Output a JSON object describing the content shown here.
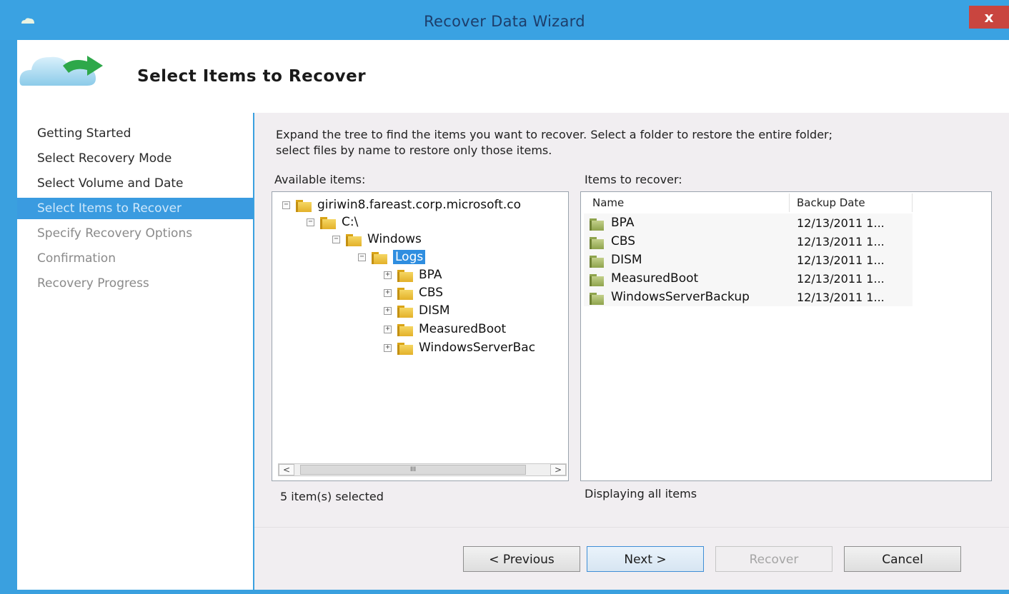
{
  "window": {
    "title": "Recover Data Wizard",
    "close_label": "x"
  },
  "header": {
    "title": "Select Items to Recover"
  },
  "sidebar": {
    "steps": [
      {
        "label": "Getting Started",
        "state": "done"
      },
      {
        "label": "Select Recovery Mode",
        "state": "done"
      },
      {
        "label": "Select Volume and Date",
        "state": "done"
      },
      {
        "label": "Select Items to Recover",
        "state": "active"
      },
      {
        "label": "Specify Recovery Options",
        "state": "pending"
      },
      {
        "label": "Confirmation",
        "state": "pending"
      },
      {
        "label": "Recovery Progress",
        "state": "pending"
      }
    ]
  },
  "main": {
    "description_line1": "Expand the tree to find the items you want to recover. Select a folder to restore the entire folder;",
    "description_line2": "select files by name to restore only those items.",
    "available_label": "Available items:",
    "recover_label": "Items to recover:",
    "tree": {
      "root": "giriwin8.fareast.corp.microsoft.co",
      "drive": "C:\\",
      "windows": "Windows",
      "logs": "Logs",
      "children": [
        "BPA",
        "CBS",
        "DISM",
        "MeasuredBoot",
        "WindowsServerBac"
      ]
    },
    "scroll_thumb_label": "III",
    "scroll_left": "<",
    "scroll_right": ">",
    "list": {
      "col_name": "Name",
      "col_date": "Backup Date",
      "rows": [
        {
          "name": "BPA",
          "date": "12/13/2011 1..."
        },
        {
          "name": "CBS",
          "date": "12/13/2011 1..."
        },
        {
          "name": "DISM",
          "date": "12/13/2011 1..."
        },
        {
          "name": "MeasuredBoot",
          "date": "12/13/2011 1..."
        },
        {
          "name": "WindowsServerBackup",
          "date": "12/13/2011 1..."
        }
      ]
    },
    "status_left": "5 item(s) selected",
    "status_right": "Displaying all items"
  },
  "buttons": {
    "previous": "< Previous",
    "next": "Next >",
    "recover": "Recover",
    "cancel": "Cancel"
  },
  "colors": {
    "titlebar": "#3aa2e2",
    "active_step": "#3a9be0",
    "close_button": "#c9453f"
  }
}
